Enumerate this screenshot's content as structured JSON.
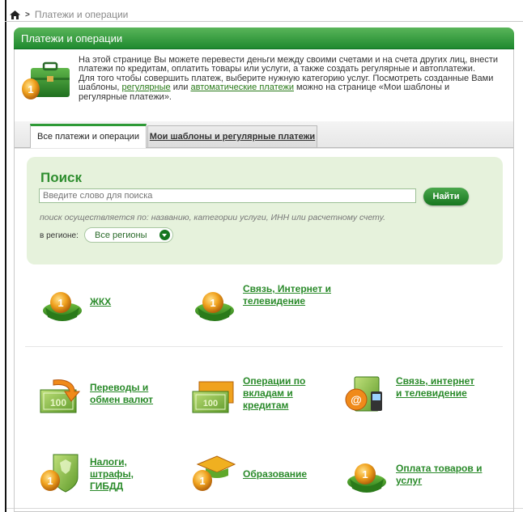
{
  "breadcrumb": {
    "label": "Платежи и операции"
  },
  "panel": {
    "title": "Платежи и операции"
  },
  "intro": {
    "text_1": "На этой странице Вы можете перевести деньги между своими счетами и на счета других лиц, внести платежи по кредитам, оплатить товары или услуги, а также создать регулярные и автоплатежи.",
    "text_2": "Для того чтобы совершить платеж, выберите нужную категорию услуг. Посмотреть созданные Вами шаблоны,",
    "link_regular": "регулярные",
    "text_or": "или",
    "link_auto": "автоматические платежи",
    "text_3": "можно на странице «Мои шаблоны и регулярные платежи»."
  },
  "tabs": [
    {
      "label": "Все платежи и операции",
      "active": true
    },
    {
      "label": "Мои шаблоны и регулярные платежи",
      "active": false
    }
  ],
  "search": {
    "title": "Поиск",
    "placeholder": "Введите слово для поиска",
    "button": "Найти",
    "hint": "поиск осуществляется по: названию, категории услуги, ИНН или расчетному счету.",
    "region_label": "в регионе:",
    "region_value": "Все регионы"
  },
  "categories": [
    {
      "label": "ЖКХ",
      "icon": "basket-coin-icon"
    },
    {
      "label": "Связь, Интернет и телевидение",
      "icon": "basket-coin-icon"
    },
    {
      "label": "Переводы и обмен валют",
      "icon": "money-transfer-icon"
    },
    {
      "label": "Операции по вкладам и кредитам",
      "icon": "banknotes-icon"
    },
    {
      "label": "Связь, интернет и телевидение",
      "icon": "phone-at-icon"
    },
    {
      "label": "Налоги, штрафы, ГИБДД",
      "icon": "emblem-coin-icon"
    },
    {
      "label": "Образование",
      "icon": "graduation-cap-coin-icon"
    },
    {
      "label": "Оплата товаров и услуг",
      "icon": "basket-coin-icon"
    }
  ],
  "colors": {
    "brand_green": "#1f8a2f",
    "link_green": "#2a8a2a",
    "search_bg": "#e6f2dc"
  }
}
